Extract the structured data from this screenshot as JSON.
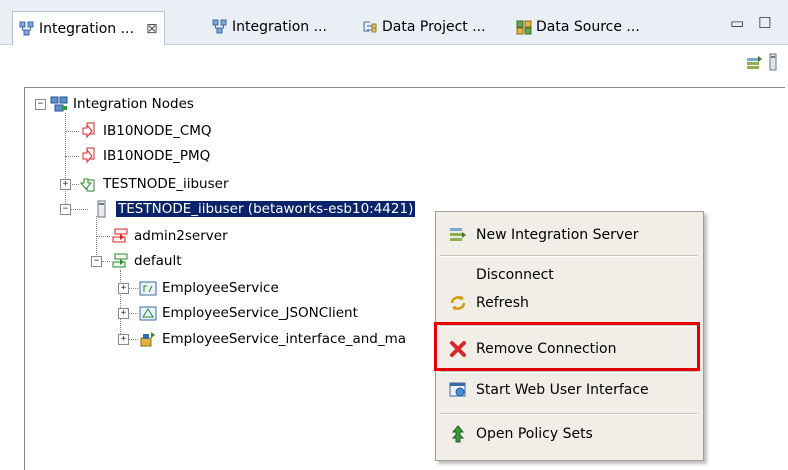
{
  "tabs": [
    {
      "label": "Integration ...",
      "icon": "integration-nodes-icon",
      "active": true
    },
    {
      "label": "Integration ...",
      "icon": "integration-nodes-icon"
    },
    {
      "label": "Data Project ...",
      "icon": "data-project-icon"
    },
    {
      "label": "Data Source ...",
      "icon": "data-source-icon"
    }
  ],
  "tab_close_glyph": "⊠",
  "window": {
    "minimize": "▭",
    "maximize": "☐"
  },
  "toolbar": {
    "icons": [
      "add-server-icon",
      "view-menu-icon"
    ]
  },
  "tree": {
    "root": "Integration Nodes",
    "nodes": [
      {
        "label": "IB10NODE_CMQ",
        "icon": "node-stopped-icon"
      },
      {
        "label": "IB10NODE_PMQ",
        "icon": "node-stopped-icon"
      },
      {
        "label": "TESTNODE_iibuser",
        "icon": "node-running-icon"
      },
      {
        "label": "TESTNODE_iibuser (betaworks-esb10:4421)",
        "icon": "remote-node-icon",
        "selected": true
      }
    ],
    "servers": [
      {
        "label": "admin2server",
        "icon": "server-stopped-icon"
      },
      {
        "label": "default",
        "icon": "server-running-icon"
      }
    ],
    "apps": [
      {
        "label": "EmployeeService",
        "icon": "rest-api-icon"
      },
      {
        "label": "EmployeeService_JSONClient",
        "icon": "application-icon"
      },
      {
        "label": "EmployeeService_interface_and_ma",
        "icon": "service-icon"
      }
    ]
  },
  "context_menu": {
    "items": [
      {
        "label": "New Integration Server",
        "icon": "new-server-icon"
      },
      {
        "label": "Disconnect",
        "icon": ""
      },
      {
        "label": "Refresh",
        "icon": "refresh-icon"
      },
      {
        "label": "Remove Connection",
        "icon": "remove-icon",
        "highlighted": true
      },
      {
        "label": "Start Web User Interface",
        "icon": "web-ui-icon"
      },
      {
        "label": "Open Policy Sets",
        "icon": "policy-sets-icon"
      }
    ]
  },
  "colors": {
    "selection": "#0a246a",
    "highlight_box": "#e40000",
    "menu_bg": "#f0eee6",
    "remove_icon": "#d9262a"
  }
}
